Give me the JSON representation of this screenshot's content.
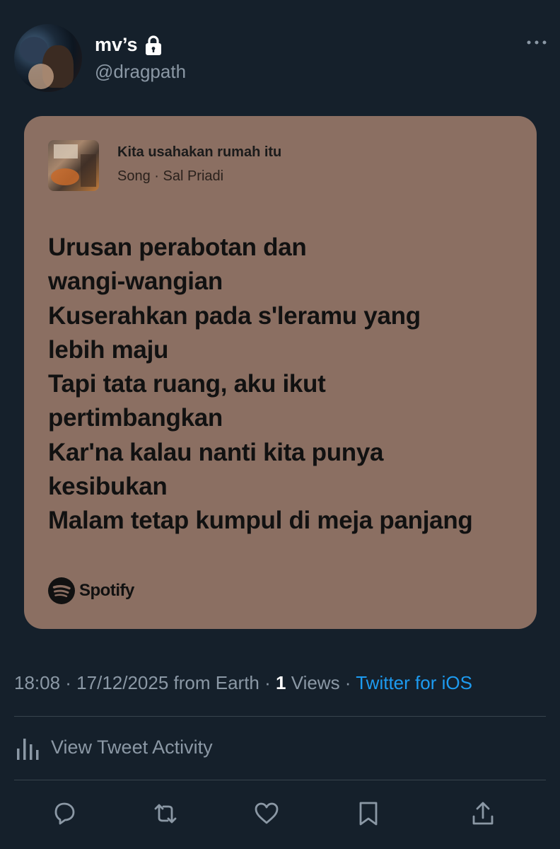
{
  "tweet": {
    "display_name": "mv’s",
    "handle": "@dragpath",
    "timestamp": "18:08 · 17/12/2025 from Earth",
    "separator": " · ",
    "views_count": "1",
    "views_label": " Views",
    "separator2": " · ",
    "client": "Twitter for iOS"
  },
  "spotify_card": {
    "song_title": "Kita usahakan rumah itu",
    "song_subtitle": "Song · Sal Priadi",
    "lyrics": [
      "Urusan perabotan dan",
      "wangi-wangian",
      "Kuserahkan pada s'leramu yang",
      "lebih maju",
      "Tapi tata ruang, aku ikut",
      "pertimbangkan",
      "Kar'na kalau nanti kita punya",
      "kesibukan",
      "Malam tetap kumpul di meja panjang"
    ],
    "brand": "Spotify",
    "card_color": "#8b6f62"
  },
  "activity": {
    "label": "View Tweet Activity"
  },
  "actions": [
    "reply-icon",
    "retweet-icon",
    "like-icon",
    "bookmark-icon",
    "share-icon"
  ],
  "colors": {
    "background": "#15202b",
    "accent": "#1d9bf0",
    "muted": "#8b98a5"
  }
}
